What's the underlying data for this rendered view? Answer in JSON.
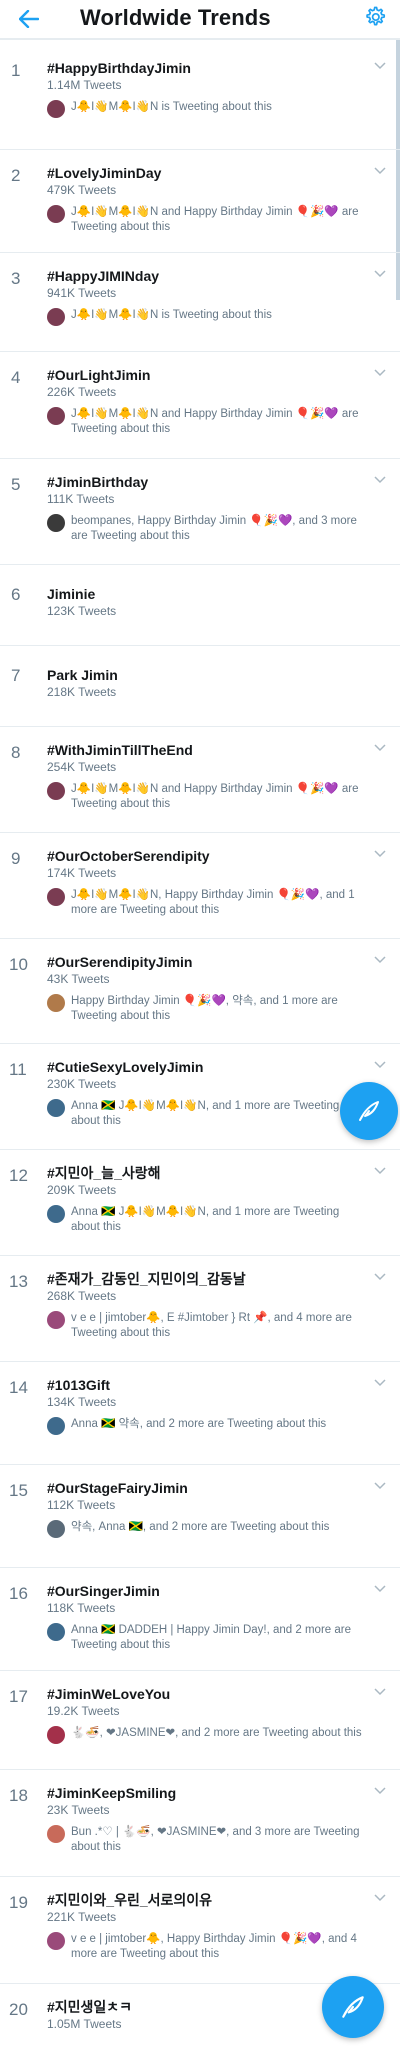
{
  "header": {
    "title": "Worldwide Trends",
    "back_icon": "arrow-left-icon",
    "settings_icon": "gear-icon",
    "accent": "#1da1f2"
  },
  "trends": [
    {
      "rank": "1",
      "name": "#HappyBirthdayJimin",
      "count": "1.14M Tweets",
      "context": "J🐥I👋M🐥I👋N is Tweeting about this",
      "avatar_color": "#7a3c52"
    },
    {
      "rank": "2",
      "name": "#LovelyJiminDay",
      "count": "479K Tweets",
      "context": "J🐥I👋M🐥I👋N and Happy Birthday Jimin 🎈🎉💜 are Tweeting about this",
      "avatar_color": "#7a3c52"
    },
    {
      "rank": "3",
      "name": "#HappyJIMINday",
      "count": "941K Tweets",
      "context": "J🐥I👋M🐥I👋N is Tweeting about this",
      "avatar_color": "#7a3c52"
    },
    {
      "rank": "4",
      "name": "#OurLightJimin",
      "count": "226K Tweets",
      "context": "J🐥I👋M🐥I👋N and Happy Birthday Jimin 🎈🎉💜 are Tweeting about this",
      "avatar_color": "#7a3c52"
    },
    {
      "rank": "5",
      "name": "#JiminBirthday",
      "count": "111K Tweets",
      "context": "beompanes, Happy Birthday Jimin 🎈🎉💜, and 3 more are Tweeting about this",
      "avatar_color": "#3a3a3a"
    },
    {
      "rank": "6",
      "name": "Jiminie",
      "count": "123K Tweets",
      "context": "",
      "avatar_color": ""
    },
    {
      "rank": "7",
      "name": "Park Jimin",
      "count": "218K Tweets",
      "context": "",
      "avatar_color": ""
    },
    {
      "rank": "8",
      "name": "#WithJiminTillTheEnd",
      "count": "254K Tweets",
      "context": "J🐥I👋M🐥I👋N and Happy Birthday Jimin 🎈🎉💜 are Tweeting about this",
      "avatar_color": "#7a3c52"
    },
    {
      "rank": "9",
      "name": "#OurOctoberSerendipity",
      "count": "174K Tweets",
      "context": "J🐥I👋M🐥I👋N, Happy Birthday Jimin 🎈🎉💜, and 1 more are Tweeting about this",
      "avatar_color": "#7a3c52"
    },
    {
      "rank": "10",
      "name": "#OurSerendipityJimin",
      "count": "43K Tweets",
      "context": "Happy Birthday Jimin 🎈🎉💜, 약속, and 1 more are Tweeting about this",
      "avatar_color": "#b07a4a"
    },
    {
      "rank": "11",
      "name": "#CutieSexyLovelyJimin",
      "count": "230K Tweets",
      "context": "Anna 🇯🇲 J🐥I👋M🐥I👋N, and 1 more are Tweeting about this",
      "avatar_color": "#3e6a8c"
    },
    {
      "rank": "12",
      "name": "#지민아_늘_사랑해",
      "count": "209K Tweets",
      "context": "Anna 🇯🇲 J🐥I👋M🐥I👋N, and 1 more are Tweeting about this",
      "avatar_color": "#3e6a8c"
    },
    {
      "rank": "13",
      "name": "#존재가_감동인_지민이의_감동날",
      "count": "268K Tweets",
      "context": "v e e | jimtober🐥, E #Jimtober } Rt 📌, and 4 more are Tweeting about this",
      "avatar_color": "#9a4a7a"
    },
    {
      "rank": "14",
      "name": "#1013Gift",
      "count": "134K Tweets",
      "context": "Anna 🇯🇲 약속, and 2 more are Tweeting about this",
      "avatar_color": "#3e6a8c"
    },
    {
      "rank": "15",
      "name": "#OurStageFairyJimin",
      "count": "112K Tweets",
      "context": "약속, Anna 🇯🇲, and 2 more are Tweeting about this",
      "avatar_color": "#5a6a78"
    },
    {
      "rank": "16",
      "name": "#OurSingerJimin",
      "count": "118K Tweets",
      "context": "Anna 🇯🇲 DADDEH | Happy Jimin Day!, and 2 more are Tweeting about this",
      "avatar_color": "#3e6a8c"
    },
    {
      "rank": "17",
      "name": "#JiminWeLoveYou",
      "count": "19.2K Tweets",
      "context": "🐇🍜, ❤JASMINE❤, and 2 more are Tweeting about this",
      "avatar_color": "#a3304a"
    },
    {
      "rank": "18",
      "name": "#JiminKeepSmiling",
      "count": "23K Tweets",
      "context": "Bun .*♡ | 🐇🍜, ❤JASMINE❤, and 3 more are Tweeting about this",
      "avatar_color": "#c86a5a"
    },
    {
      "rank": "19",
      "name": "#지민이와_우린_서로의이유",
      "count": "221K Tweets",
      "context": "v e e | jimtober🐥, Happy Birthday Jimin 🎈🎉💜, and 4 more are Tweeting about this",
      "avatar_color": "#9a4a7a"
    },
    {
      "rank": "20",
      "name": "#지민생일ㅊㅋ",
      "count": "1.05M Tweets",
      "context": "",
      "avatar_color": ""
    }
  ],
  "compose_icon": "feather-compose-icon"
}
